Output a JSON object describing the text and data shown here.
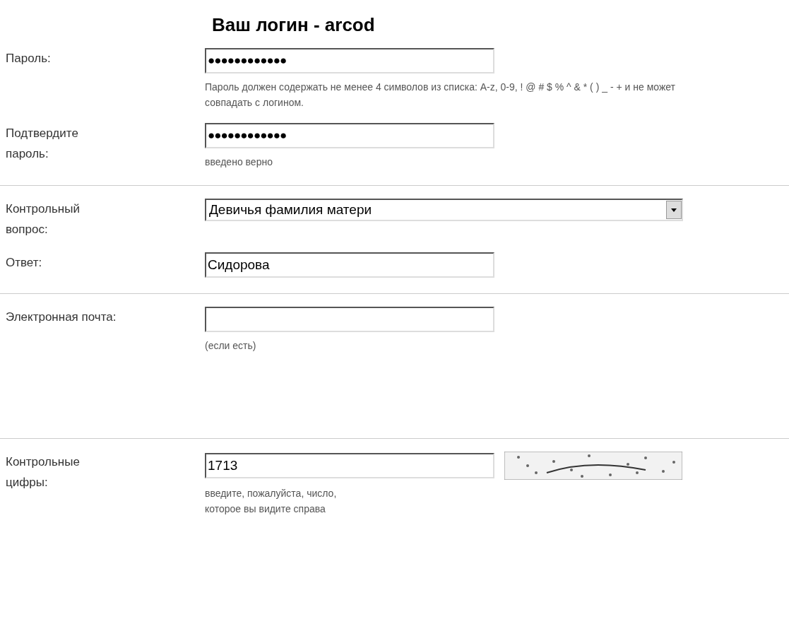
{
  "title": "Ваш логин - arcod",
  "sections": [
    {
      "rows": [
        {
          "label": "Пароль:",
          "field": {
            "kind": "password",
            "value": "●●●●●●●●●●●●"
          },
          "hint": "Пароль должен содержать не менее 4 символов из списка: A-z, 0-9, ! @ # $ % ^ & * ( ) _ - + и не может совпадать с логином."
        },
        {
          "label": "Подтвердите\nпароль:",
          "field": {
            "kind": "password",
            "value": "●●●●●●●●●●●●"
          },
          "hint": "введено верно"
        }
      ]
    },
    {
      "rows": [
        {
          "label": "Контрольный\nвопрос:",
          "field": {
            "kind": "select",
            "value": "Девичья фамилия матери"
          }
        },
        {
          "label": "Ответ:",
          "field": {
            "kind": "text",
            "value": "Сидорова"
          }
        }
      ]
    },
    {
      "rows": [
        {
          "label": "Электронная почта:",
          "field": {
            "kind": "text"
          },
          "hint": "(если есть)"
        }
      ]
    },
    {
      "rows": [
        {
          "label": "Контрольные\nцифры:",
          "field": {
            "kind": "text",
            "value": "1713"
          },
          "hint": "введите, пожалуйста, число, которое вы видите справа",
          "captcha": true
        }
      ]
    }
  ]
}
